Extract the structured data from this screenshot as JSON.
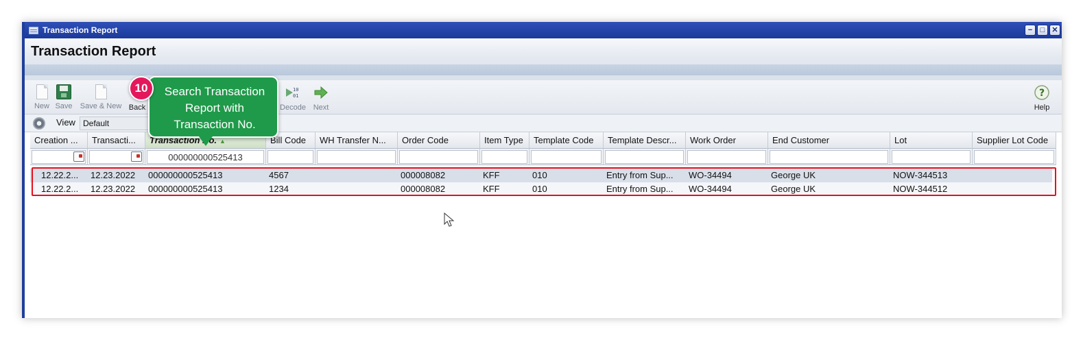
{
  "window": {
    "title": "Transaction Report",
    "controls": [
      "−",
      "□",
      "✕"
    ]
  },
  "page_title": "Transaction Report",
  "toolbar": {
    "new_label": "New",
    "save_label": "Save",
    "save_new_label": "Save & New",
    "back_label": "Back",
    "decode_label": "Decode",
    "next_label": "Next",
    "help_label": "Help"
  },
  "viewbar": {
    "label": "View",
    "selected": "Default"
  },
  "grid": {
    "columns": [
      "Creation ...",
      "Transacti...",
      "Transaction No.",
      "Bill Code",
      "WH Transfer N...",
      "Order Code",
      "Item Type",
      "Template Code",
      "Template Descr...",
      "Work Order",
      "End Customer",
      "Lot",
      "Supplier Lot Code"
    ],
    "sort_column": "Transaction No.",
    "filter_transaction_no": "000000000525413",
    "rows": [
      [
        "12.22.2...",
        "12.23.2022",
        "000000000525413",
        "4567",
        "",
        "000008082",
        "KFF",
        "010",
        "Entry from Sup...",
        "WO-34494",
        "George UK",
        "NOW-344513",
        ""
      ],
      [
        "12.22.2...",
        "12.23.2022",
        "000000000525413",
        "1234",
        "",
        "000008082",
        "KFF",
        "010",
        "Entry from Sup...",
        "WO-34494",
        "George UK",
        "NOW-344512",
        ""
      ]
    ]
  },
  "callout": {
    "step": "10",
    "text": "Search Transaction Report with Transaction No."
  },
  "colors": {
    "title_bar": "#1f3f9c",
    "callout": "#1f9a4a",
    "badge": "#e4175c",
    "highlight": "#e5101c"
  }
}
